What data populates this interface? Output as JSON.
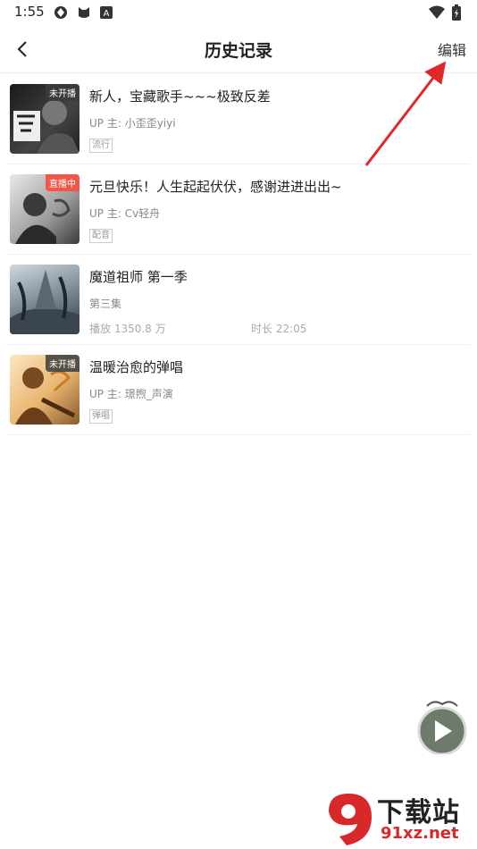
{
  "status_bar": {
    "time": "1:55",
    "icons": [
      "app-icon",
      "cat-icon",
      "a-icon",
      "wifi-icon",
      "battery-icon"
    ]
  },
  "header": {
    "title": "历史记录",
    "edit_label": "编辑"
  },
  "items": [
    {
      "title": "新人，宝藏歌手~~~极致反差",
      "sub": "UP 主: 小歪歪yiyi",
      "tag": "流行",
      "badge": "未开播",
      "badge_color": "gray"
    },
    {
      "title": "元旦快乐！人生起起伏伏，感谢进进出出~",
      "sub": "UP 主: Cv轻舟",
      "tag": "配音",
      "badge": "直播中",
      "badge_color": "red"
    },
    {
      "title": "魔道祖师 第一季",
      "sub": "第三集",
      "meta_left": "播放 1350.8 万",
      "meta_right": "时长 22:05"
    },
    {
      "title": "温暖治愈的弹唱",
      "sub": "UP 主: 璟煦_声演",
      "tag": "弹唱",
      "badge": "未开播",
      "badge_color": "gray"
    }
  ],
  "watermark": {
    "big": "下载站",
    "url": "91xz.net"
  },
  "colors": {
    "accent_red": "#f0564a",
    "arrow_red": "#e0272a"
  }
}
